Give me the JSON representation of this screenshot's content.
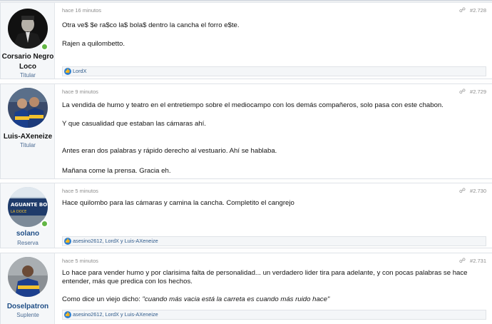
{
  "posts": [
    {
      "user": {
        "name_line1": "Corsario Negro",
        "name_line2": "Loco",
        "title": "Titular",
        "avatar": "dark-suit-avatar"
      },
      "time": "hace 16 minutos",
      "number": "#2.728",
      "body": [
        "Otra ve$ $e ra$co la$ bola$ dentro la cancha el forro e$te.",
        "Rajen a quilombetto."
      ],
      "reactions": "LordX"
    },
    {
      "user": {
        "name": "Luis-AXeneize",
        "title": "Titular",
        "avatar": "players-avatar"
      },
      "time": "hace 9 minutos",
      "number": "#2.729",
      "body": [
        "La vendida de humo y teatro en el entretiempo sobre el mediocampo con los demás compañeros, solo pasa con este chabon.",
        "Y que casualidad que estaban las cámaras ahí.",
        "Antes eran dos palabras y rápido derecho al vestuario. Ahí se hablaba.",
        "Mañana come la prensa. Gracia eh."
      ]
    },
    {
      "user": {
        "name": "solano",
        "title": "Reserva",
        "avatar": "banner-avatar"
      },
      "time": "hace 5 minutos",
      "number": "#2.730",
      "body": [
        "Hace quilombo para las cámaras y camina la cancha. Completito el cangrejo"
      ],
      "reactions": "asesino2612, LordX y Luis-AXeneize"
    },
    {
      "user": {
        "name": "Doselpatron",
        "title": "Suplente",
        "avatar": "player-avatar"
      },
      "time": "hace 5 minutos",
      "number": "#2.731",
      "body": [
        "Lo hace para vender humo y por clarisima falta de personalidad... un verdadero lider tira para adelante, y con pocas palabras se hace",
        "entender, más que predica con los hechos."
      ],
      "quote_prefix": "Como dice un viejo dicho: ",
      "quote": "\"cuando más vacia está la carreta es cuando más ruido hace\"",
      "reactions": "asesino2612, LordX y Luis-AXeneize"
    }
  ],
  "colors": {
    "accent": "#4a6b93",
    "online": "#63b745",
    "like": "#2d7fd0"
  },
  "icons": {
    "share": "share-icon",
    "like": "like-icon",
    "online": "online-indicator"
  }
}
